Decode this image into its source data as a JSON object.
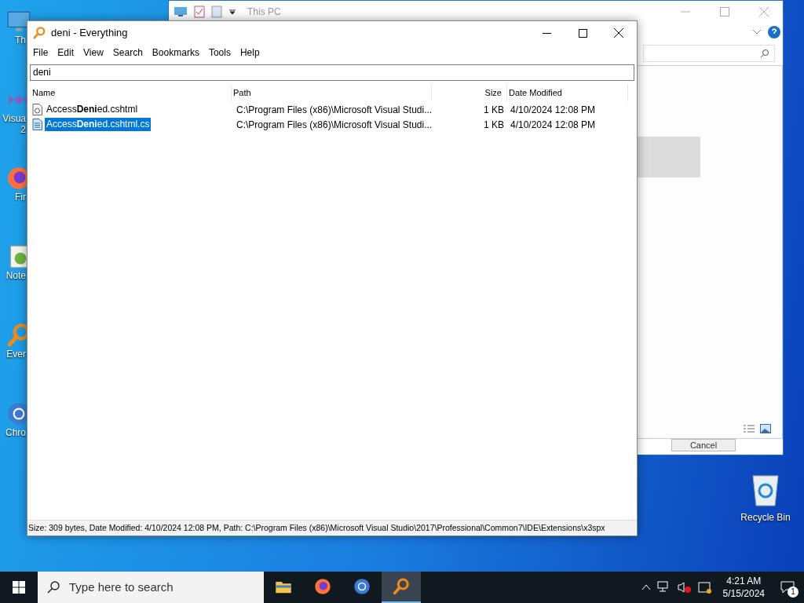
{
  "desktop_icons": [
    {
      "kind": "pc",
      "label_lines": [
        "Th"
      ]
    },
    {
      "kind": "vs",
      "label_lines": [
        "Visua",
        "2"
      ]
    },
    {
      "kind": "firefox",
      "label_lines": [
        "Fir"
      ]
    },
    {
      "kind": "notepad",
      "label_lines": [
        "Note"
      ]
    },
    {
      "kind": "everything",
      "label_lines": [
        "Ever"
      ]
    },
    {
      "kind": "chrome",
      "label_lines": [
        "Chro"
      ]
    }
  ],
  "recycle_bin": {
    "label": "Recycle Bin"
  },
  "background_window": {
    "title": "This PC",
    "buttons": [
      "Cancel"
    ]
  },
  "everything": {
    "title": "deni - Everything",
    "menu": [
      "File",
      "Edit",
      "View",
      "Search",
      "Bookmarks",
      "Tools",
      "Help"
    ],
    "search": {
      "value": "deni"
    },
    "columns": [
      "Name",
      "Path",
      "Size",
      "Date Modified"
    ],
    "rows": [
      {
        "kind": "web",
        "name": "Access**Deni**ed.cshtml",
        "path": "C:\\Program Files (x86)\\Microsoft Visual Studi...",
        "size": "1 KB",
        "date": "4/10/2024 12:08 PM",
        "selected": false
      },
      {
        "kind": "code",
        "name": "Access**Deni**ed.cshtml.cs",
        "path": "C:\\Program Files (x86)\\Microsoft Visual Studi...",
        "size": "1 KB",
        "date": "4/10/2024 12:08 PM",
        "selected": true
      }
    ],
    "status_bar": "Size: 309 bytes, Date Modified: 4/10/2024 12:08 PM, Path: C:\\Program Files (x86)\\Microsoft Visual Studio\\2017\\Professional\\Common7\\IDE\\Extensions\\x3spx"
  },
  "taskbar": {
    "search_placeholder": "Type here to search",
    "apps": [
      {
        "kind": "explorer",
        "selected": false
      },
      {
        "kind": "firefox",
        "selected": false
      },
      {
        "kind": "chrome",
        "selected": false
      },
      {
        "kind": "everything",
        "selected": true
      }
    ],
    "time": "4:21 AM",
    "date": "5/15/2024",
    "notifications": "1"
  }
}
